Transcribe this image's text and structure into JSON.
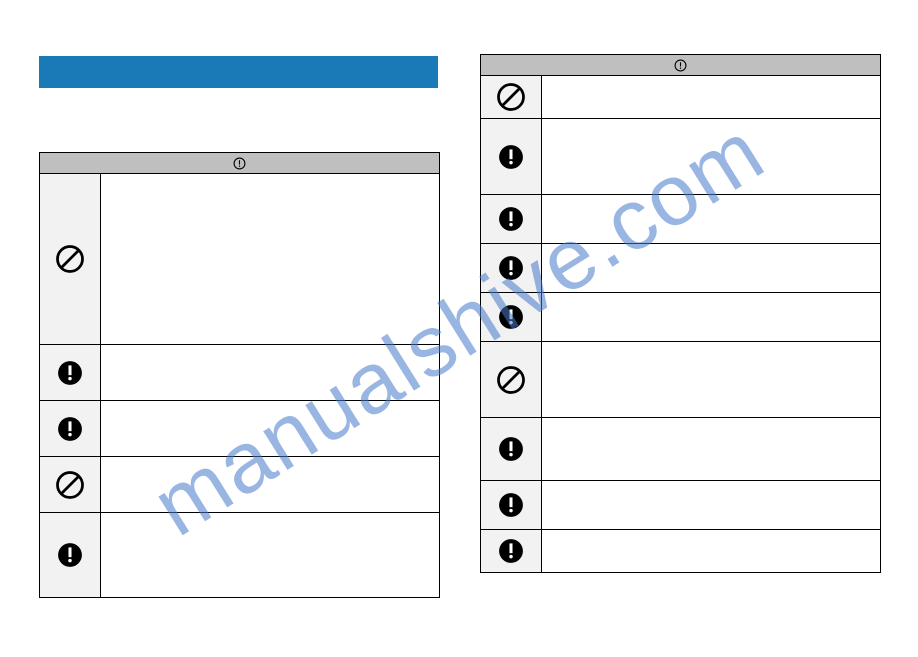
{
  "watermark": "manualshive.com",
  "header_icon": "exclaim-circle",
  "left_table": {
    "rows": [
      {
        "icon": "prohibit",
        "height_class": "lh0"
      },
      {
        "icon": "exclaim",
        "height_class": "lh1"
      },
      {
        "icon": "exclaim",
        "height_class": "lh2"
      },
      {
        "icon": "prohibit",
        "height_class": "lh3"
      },
      {
        "icon": "exclaim",
        "height_class": "lh4"
      }
    ]
  },
  "right_table": {
    "rows": [
      {
        "icon": "prohibit",
        "height_class": "rh0"
      },
      {
        "icon": "exclaim",
        "height_class": "rh1"
      },
      {
        "icon": "exclaim",
        "height_class": "rh2"
      },
      {
        "icon": "exclaim",
        "height_class": "rh3"
      },
      {
        "icon": "exclaim",
        "height_class": "rh4"
      },
      {
        "icon": "prohibit",
        "height_class": "rh5"
      },
      {
        "icon": "exclaim",
        "height_class": "rh6"
      },
      {
        "icon": "exclaim",
        "height_class": "rh7"
      },
      {
        "icon": "exclaim",
        "height_class": "rh8"
      }
    ]
  }
}
